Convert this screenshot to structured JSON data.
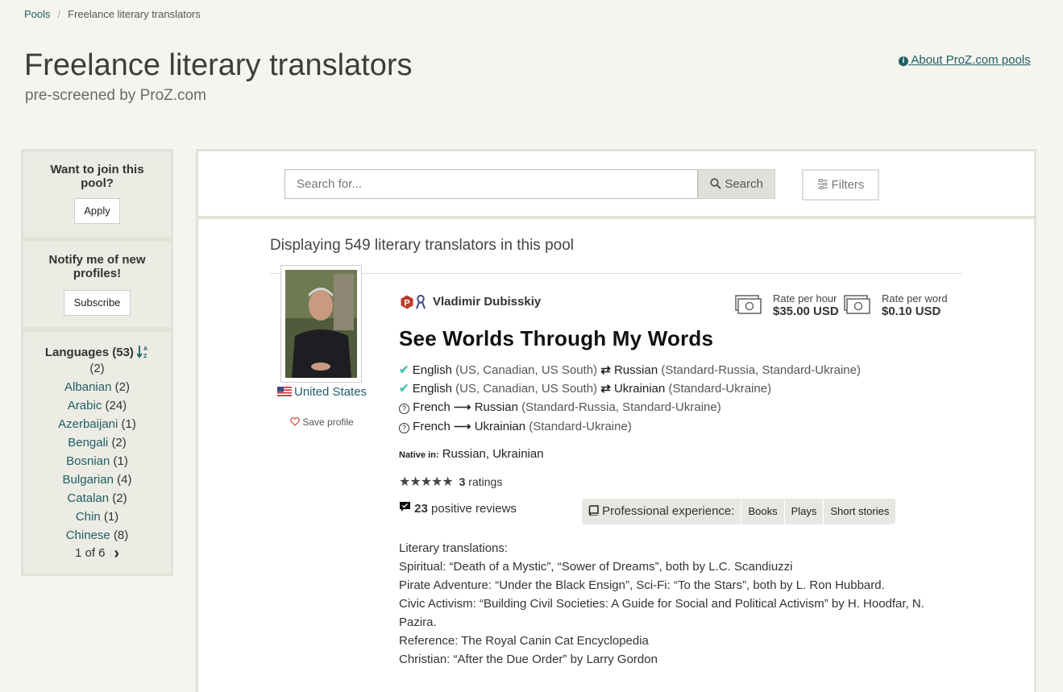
{
  "breadcrumb": {
    "root": "Pools",
    "separator": "/",
    "current": "Freelance literary translators"
  },
  "header": {
    "title": "Freelance literary translators",
    "subtitle": "pre-screened by ProZ.com",
    "about_link": "About ProZ.com pools"
  },
  "sidebar": {
    "join": {
      "heading": "Want to join this pool?",
      "button": "Apply"
    },
    "notify": {
      "heading": "Notify me of new profiles!",
      "button": "Subscribe"
    },
    "languages": {
      "heading": "Languages (53)",
      "items": [
        {
          "label": "",
          "count": "(2)"
        },
        {
          "label": "Albanian",
          "count": "(2)"
        },
        {
          "label": "Arabic",
          "count": "(24)"
        },
        {
          "label": "Azerbaijani",
          "count": "(1)"
        },
        {
          "label": "Bengali",
          "count": "(2)"
        },
        {
          "label": "Bosnian",
          "count": "(1)"
        },
        {
          "label": "Bulgarian",
          "count": "(4)"
        },
        {
          "label": "Catalan",
          "count": "(2)"
        },
        {
          "label": "Chin",
          "count": "(1)"
        },
        {
          "label": "Chinese",
          "count": "(8)"
        }
      ],
      "pager": "1 of 6"
    }
  },
  "search": {
    "placeholder": "Search for...",
    "button": "Search",
    "filters": "Filters"
  },
  "results": {
    "summary": "Displaying 549 literary translators in this pool"
  },
  "profile": {
    "name": "Vladimir Dubisskiy",
    "country": "United States",
    "save": "Save profile",
    "headline": "See Worlds Through My Words",
    "pairs": [
      {
        "src": "English",
        "src_var": "(US, Canadian, US South)",
        "tgt": "Russian",
        "tgt_var": "(Standard-Russia, Standard-Ukraine)"
      },
      {
        "src": "English",
        "src_var": "(US, Canadian, US South)",
        "tgt": "Ukrainian",
        "tgt_var": "(Standard-Ukraine)"
      },
      {
        "src": "French",
        "src_var": "",
        "tgt": "Russian",
        "tgt_var": "(Standard-Russia, Standard-Ukraine)"
      },
      {
        "src": "French",
        "src_var": "",
        "tgt": "Ukrainian",
        "tgt_var": "(Standard-Ukraine)"
      }
    ],
    "native_label": "Native in:",
    "native_value": "Russian, Ukrainian",
    "rating_stars": 5,
    "ratings_count": "3",
    "ratings_label": "ratings",
    "reviews_count": "23",
    "reviews_label": "positive reviews",
    "rate_hour_label": "Rate per hour",
    "rate_hour_value": "$35.00 USD",
    "rate_word_label": "Rate per word",
    "rate_word_value": "$0.10 USD",
    "experience_label": "Professional experience:",
    "experience_tags": [
      "Books",
      "Plays",
      "Short stories"
    ],
    "bio": [
      "Literary translations:",
      "Spiritual: “Death of a Mystic”, “Sower of Dreams”, both by L.C. Scandiuzzi",
      "Pirate Adventure: “Under the Black Ensign”, Sci-Fi: “To the Stars”, both by L. Ron Hubbard.",
      "Civic Activism: “Building Civil Societies: A Guide for Social and Political Activism” by H. Hoodfar, N. Pazira.",
      "Reference: The Royal Canin Cat Encyclopedia",
      "Christian: “After the Due Order” by Larry Gordon"
    ]
  },
  "colors": {
    "link": "#1f5f63",
    "background": "#f5f4ee",
    "check": "#4cc3b2",
    "heart": "#d9534f",
    "badge": "#c0392b"
  }
}
